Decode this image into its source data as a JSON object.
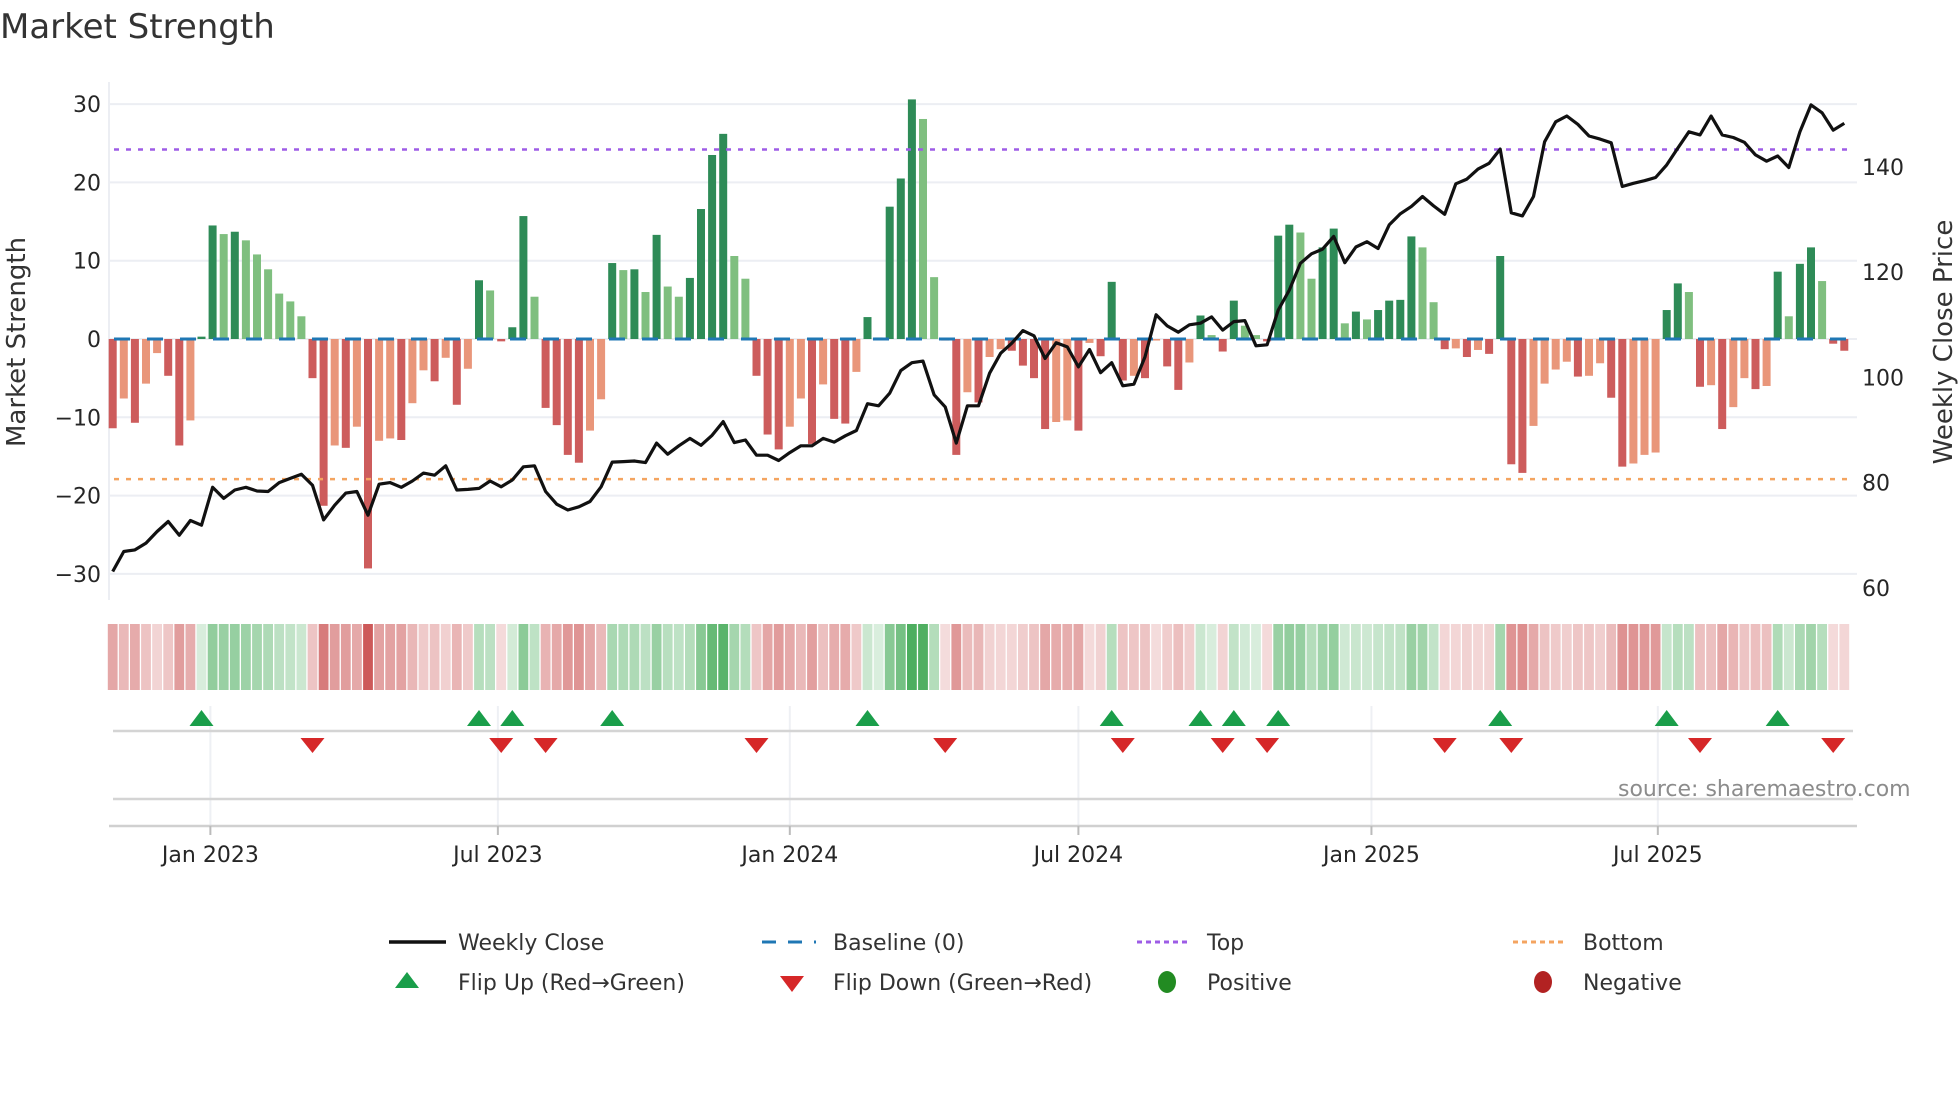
{
  "chart_data": {
    "type": "bar",
    "title": "Market Strength",
    "ylabel": "Market Strength",
    "y2label": "Weekly Close Price",
    "ylim": [
      -33,
      33
    ],
    "y2lim": [
      58,
      152
    ],
    "yticks": [
      30,
      20,
      10,
      0,
      -10,
      -20,
      -30
    ],
    "ytick_labels": [
      "30",
      "20",
      "10",
      "0",
      "−10",
      "−20",
      "−30"
    ],
    "y2ticks": [
      140,
      120,
      100,
      80,
      60
    ],
    "y2tick_labels": [
      "140",
      "120",
      "100",
      "80",
      "60"
    ],
    "xticks": [
      {
        "label": "Jan 2023",
        "week": 8.8
      },
      {
        "label": "Jul 2023",
        "week": 34.7
      },
      {
        "label": "Jan 2024",
        "week": 61.0
      },
      {
        "label": "Jul 2024",
        "week": 87.0
      },
      {
        "label": "Jan 2025",
        "week": 113.4
      },
      {
        "label": "Jul 2025",
        "week": 139.2
      }
    ],
    "grid": true,
    "top_level": 24.2,
    "bottom_level": -17.9,
    "baseline": 0,
    "strength": [
      -11.4,
      -7.6,
      -10.7,
      -5.7,
      -1.8,
      -4.7,
      -13.6,
      -10.4,
      0.3,
      14.5,
      13.4,
      13.7,
      12.6,
      10.8,
      8.9,
      5.8,
      4.8,
      2.9,
      -5.0,
      -21.3,
      -13.6,
      -13.9,
      -11.2,
      -29.3,
      -13.0,
      -12.7,
      -12.9,
      -8.2,
      -4.0,
      -5.4,
      -2.4,
      -8.4,
      -3.8,
      7.5,
      6.2,
      -0.3,
      1.5,
      15.7,
      5.4,
      -8.8,
      -11.0,
      -14.8,
      -15.8,
      -11.7,
      -7.7,
      9.7,
      8.8,
      8.9,
      6.0,
      13.3,
      6.7,
      5.4,
      7.8,
      16.6,
      23.5,
      26.2,
      10.6,
      7.7,
      -4.7,
      -12.2,
      -14.1,
      -11.2,
      -7.6,
      -13.4,
      -5.8,
      -10.2,
      -10.8,
      -4.2,
      2.8,
      0.2,
      16.9,
      20.5,
      30.6,
      28.1,
      7.9,
      -0.2,
      -14.8,
      -6.8,
      -8.1,
      -2.3,
      -1.3,
      -1.5,
      -3.4,
      -5.0,
      -11.5,
      -10.6,
      -10.4,
      -11.7,
      -0.5,
      -2.2,
      7.3,
      -5.3,
      -4.7,
      -5.0,
      -0.2,
      -3.5,
      -6.5,
      -3.0,
      3.0,
      0.5,
      -1.6,
      4.9,
      1.7,
      0.5,
      -0.3,
      13.2,
      14.6,
      13.6,
      7.7,
      11.7,
      14.1,
      2.0,
      3.5,
      2.5,
      3.7,
      4.9,
      5.0,
      13.1,
      11.7,
      4.7,
      -1.3,
      -1.2,
      -2.3,
      -1.4,
      -1.9,
      10.6,
      -16.0,
      -17.1,
      -11.1,
      -5.7,
      -3.9,
      -2.9,
      -4.8,
      -4.7,
      -3.1,
      -7.5,
      -16.3,
      -15.9,
      -14.8,
      -14.5,
      3.7,
      7.1,
      6.0,
      -6.1,
      -5.9,
      -11.5,
      -8.7,
      -5.0,
      -6.4,
      -6.0,
      8.6,
      2.9,
      9.6,
      11.7,
      7.4,
      -0.6,
      -1.5
    ],
    "weekly_close": [
      63.1,
      66.9,
      67.2,
      68.5,
      70.7,
      72.6,
      70.0,
      72.8,
      71.9,
      79.1,
      77.0,
      78.6,
      79.1,
      78.4,
      78.3,
      80.0,
      80.8,
      81.6,
      79.5,
      72.9,
      75.7,
      78.0,
      78.3,
      73.8,
      79.7,
      80.0,
      79.1,
      80.3,
      81.8,
      81.4,
      83.2,
      78.6,
      78.7,
      78.9,
      80.3,
      79.2,
      80.5,
      83.0,
      83.2,
      78.3,
      75.9,
      74.8,
      75.4,
      76.4,
      79.2,
      83.9,
      84.0,
      84.1,
      83.8,
      87.5,
      85.4,
      87.0,
      88.4,
      87.1,
      89.0,
      91.6,
      87.6,
      88.1,
      85.2,
      85.2,
      84.2,
      85.7,
      87.0,
      87.0,
      88.4,
      87.7,
      88.9,
      89.9,
      95.0,
      94.6,
      97.0,
      101.3,
      102.8,
      103.1,
      96.7,
      94.4,
      87.5,
      94.6,
      94.6,
      100.8,
      104.6,
      106.5,
      108.9,
      107.9,
      103.6,
      106.6,
      105.8,
      102.0,
      105.3,
      100.9,
      102.8,
      98.4,
      98.7,
      103.9,
      111.9,
      109.8,
      108.6,
      110.0,
      110.3,
      111.5,
      109.0,
      110.6,
      110.8,
      106.0,
      106.2,
      112.8,
      116.6,
      121.7,
      123.5,
      124.4,
      126.8,
      121.8,
      124.8,
      125.8,
      124.5,
      129.0,
      131.1,
      132.5,
      134.4,
      132.6,
      131.0,
      136.8,
      137.7,
      139.6,
      140.7,
      143.4,
      131.3,
      130.7,
      134.4,
      144.8,
      148.6,
      149.7,
      148.1,
      145.9,
      145.3,
      144.6,
      136.3,
      136.9,
      137.4,
      138.0,
      140.4,
      143.6,
      146.7,
      146.1,
      149.7,
      146.1,
      145.6,
      144.7,
      142.3,
      141.1,
      142.1,
      139.9,
      146.7,
      151.8,
      150.3,
      147.0,
      148.3
    ],
    "flip_up_weeks": [
      8,
      33,
      36,
      45,
      68,
      90,
      98,
      101,
      105,
      125,
      140,
      150
    ],
    "flip_down_weeks": [
      18,
      35,
      39,
      58,
      75,
      91,
      100,
      104,
      120,
      126,
      143,
      155
    ],
    "legend": {
      "placement": "bottom",
      "entries": [
        {
          "label": "Weekly Close",
          "symbol": "line"
        },
        {
          "label": "Baseline (0)",
          "symbol": "dashed-line"
        },
        {
          "label": "Top",
          "symbol": "dotted-line"
        },
        {
          "label": "Bottom",
          "symbol": "dotted-line"
        },
        {
          "label": "Flip Up (Red→Green)",
          "symbol": "triangle-up"
        },
        {
          "label": "Flip Down (Green→Red)",
          "symbol": "triangle-down"
        },
        {
          "label": "Positive",
          "symbol": "circle"
        },
        {
          "label": "Negative",
          "symbol": "circle"
        }
      ]
    }
  },
  "source": "source: sharemaestro.com",
  "colors": {
    "positive_strong": "#2e8b57",
    "positive_weak": "#7fbf7f",
    "negative_strong": "#cd5c5c",
    "negative_weak": "#e9967a",
    "baseline": "#1f77b4",
    "top": "#9d5ce6",
    "bottom": "#f4a460",
    "close": "#111111",
    "flip_up": "#1a9e4a",
    "flip_down": "#d62728",
    "positive_dot": "#228b22",
    "negative_dot": "#b22222"
  }
}
